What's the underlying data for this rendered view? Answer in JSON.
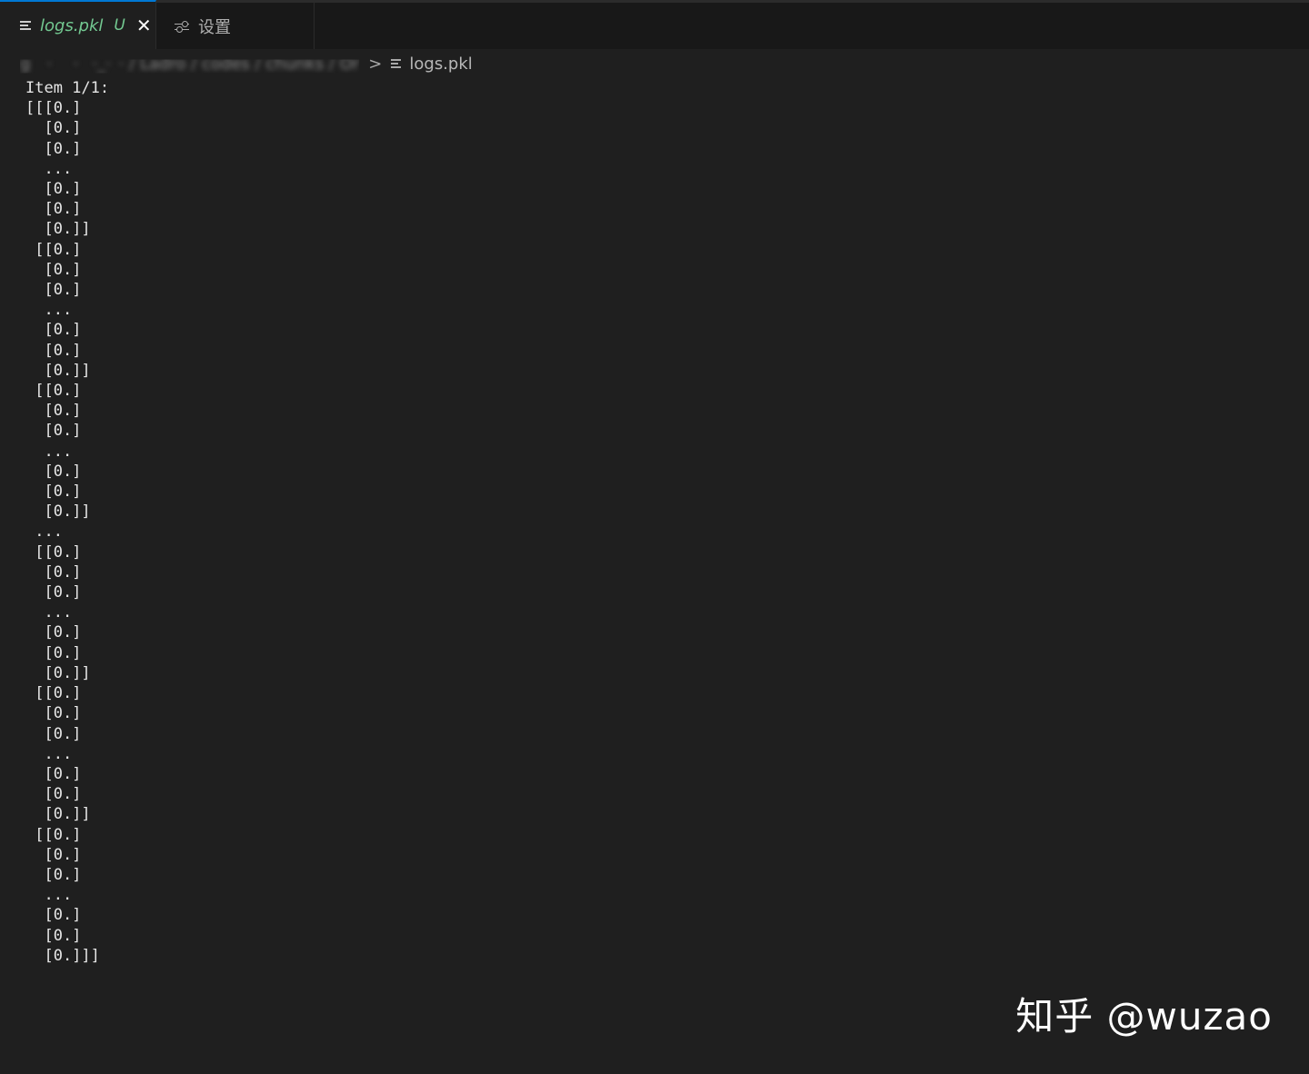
{
  "tabs": [
    {
      "label": "logs.pkl",
      "badge": "U",
      "icon": "file-lines-icon",
      "active": true
    },
    {
      "label": "设置",
      "icon": "settings-sliders-icon",
      "active": false
    }
  ],
  "breadcrumb": {
    "blurred_path": "g  ·   ·  ·_· · / Ladro / codes / chunks / Or",
    "separator": ">",
    "file": "logs.pkl"
  },
  "output": {
    "lines": [
      "Item 1/1:",
      "[[[0.]",
      "  [0.]",
      "  [0.]",
      "  ...",
      "  [0.]",
      "  [0.]",
      "  [0.]]",
      " [[0.]",
      "  [0.]",
      "  [0.]",
      "  ...",
      "  [0.]",
      "  [0.]",
      "  [0.]]",
      " [[0.]",
      "  [0.]",
      "  [0.]",
      "  ...",
      "  [0.]",
      "  [0.]",
      "  [0.]]",
      " ...",
      " [[0.]",
      "  [0.]",
      "  [0.]",
      "  ...",
      "  [0.]",
      "  [0.]",
      "  [0.]]",
      " [[0.]",
      "  [0.]",
      "  [0.]",
      "  ...",
      "  [0.]",
      "  [0.]",
      "  [0.]]",
      " [[0.]",
      "  [0.]",
      "  [0.]",
      "  ...",
      "  [0.]",
      "  [0.]",
      "  [0.]]]"
    ]
  },
  "watermark": "知乎 @wuzao",
  "colors": {
    "background": "#1f1f1f",
    "tabbar": "#181818",
    "active_tab_accent": "#0078d4",
    "untracked_green": "#73c991",
    "text": "#e6e6e6"
  }
}
